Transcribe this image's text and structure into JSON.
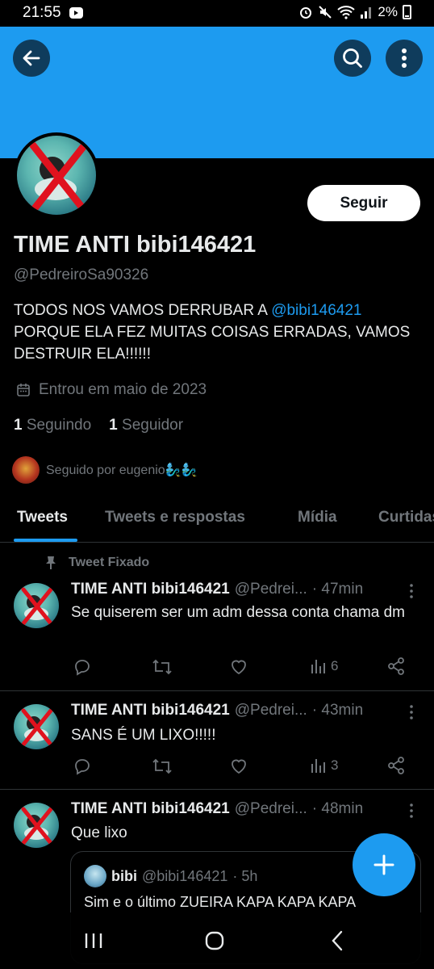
{
  "status_bar": {
    "time": "21:55",
    "battery": "2%"
  },
  "profile": {
    "name": "TIME ANTI bibi146421",
    "handle": "@PedreiroSa90326",
    "follow_label": "Seguir",
    "bio_prefix": "TODOS NOS VAMOS DERRUBAR A ",
    "bio_mention": "@bibi146421",
    "bio_suffix": "PORQUE ELA FEZ MUITAS COISAS ERRADAS, VAMOS DESTRUIR ELA!!!!!!",
    "joined": "Entrou em maio de 2023",
    "following_count": "1",
    "following_label": "Seguindo",
    "followers_count": "1",
    "followers_label": "Seguidor",
    "followed_by": "Seguido por eugenio🧞‍♂️🧞‍♂️"
  },
  "tabs": [
    {
      "label": "Tweets",
      "active": true
    },
    {
      "label": "Tweets e respostas",
      "active": false
    },
    {
      "label": "Mídia",
      "active": false
    },
    {
      "label": "Curtidas",
      "active": false
    }
  ],
  "pinned_label": "Tweet Fixado",
  "tweets": [
    {
      "name": "TIME ANTI bibi146421",
      "handle": "@Pedrei...",
      "time": "· 47min",
      "text": "Se quiserem ser um adm dessa conta chama dm",
      "views": "6"
    },
    {
      "name": "TIME ANTI bibi146421",
      "handle": "@Pedrei...",
      "time": "· 43min",
      "text": "SANS É UM LIXO!!!!!",
      "views": "3"
    },
    {
      "name": "TIME ANTI bibi146421",
      "handle": "@Pedrei...",
      "time": "· 48min",
      "text": "Que lixo",
      "quote": {
        "name": "bibi",
        "handle": "@bibi146421",
        "time": "· 5h",
        "text": "Sim e o último ZUEIRA KAPA KAPA KAPA"
      }
    }
  ],
  "colors": {
    "accent": "#1d9bf0",
    "background": "#000000",
    "muted": "#71767b",
    "text": "#e7e9ea"
  }
}
